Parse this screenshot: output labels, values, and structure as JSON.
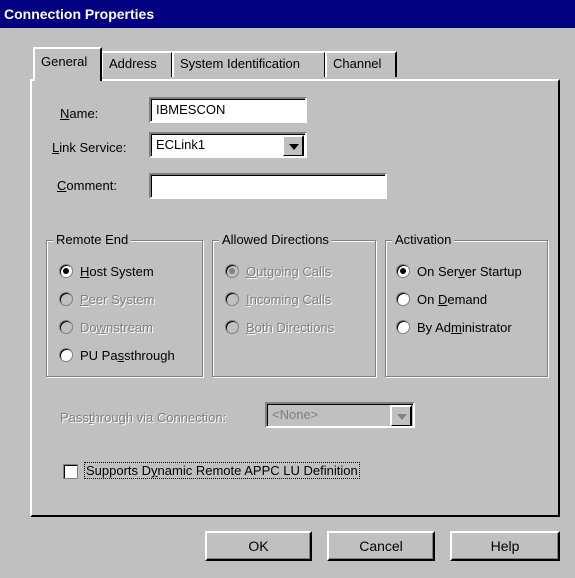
{
  "window": {
    "title": "Connection Properties"
  },
  "tabs": [
    {
      "label": "General"
    },
    {
      "label": "Address"
    },
    {
      "label": "System Identification"
    },
    {
      "label": "Channel"
    }
  ],
  "fields": {
    "name_label": "Name:",
    "name_value": "IBMESCON",
    "link_service_label": "Link Service:",
    "link_service_value": "ECLink1",
    "comment_label": "Comment:",
    "comment_value": ""
  },
  "remote_end": {
    "title": "Remote End",
    "options": [
      {
        "label": "Host System",
        "selected": true,
        "enabled": true
      },
      {
        "label": "Peer System",
        "selected": false,
        "enabled": false
      },
      {
        "label": "Downstream",
        "selected": false,
        "enabled": false
      },
      {
        "label": "PU Passthrough",
        "selected": false,
        "enabled": true
      }
    ]
  },
  "allowed_directions": {
    "title": "Allowed Directions",
    "options": [
      {
        "label": "Outgoing Calls",
        "selected": true,
        "enabled": false
      },
      {
        "label": "Incoming Calls",
        "selected": false,
        "enabled": false
      },
      {
        "label": "Both Directions",
        "selected": false,
        "enabled": false
      }
    ]
  },
  "activation": {
    "title": "Activation",
    "options": [
      {
        "label": "On Server Startup",
        "selected": true,
        "enabled": true
      },
      {
        "label": "On Demand",
        "selected": false,
        "enabled": true
      },
      {
        "label": "By Administrator",
        "selected": false,
        "enabled": true
      }
    ]
  },
  "passthrough": {
    "label": "Passthrough via Connection:",
    "value": "<None>",
    "enabled": false
  },
  "dynamic_lu": {
    "label": "Supports Dynamic Remote APPC LU Definition",
    "checked": false
  },
  "buttons": {
    "ok": "OK",
    "cancel": "Cancel",
    "help": "Help"
  }
}
